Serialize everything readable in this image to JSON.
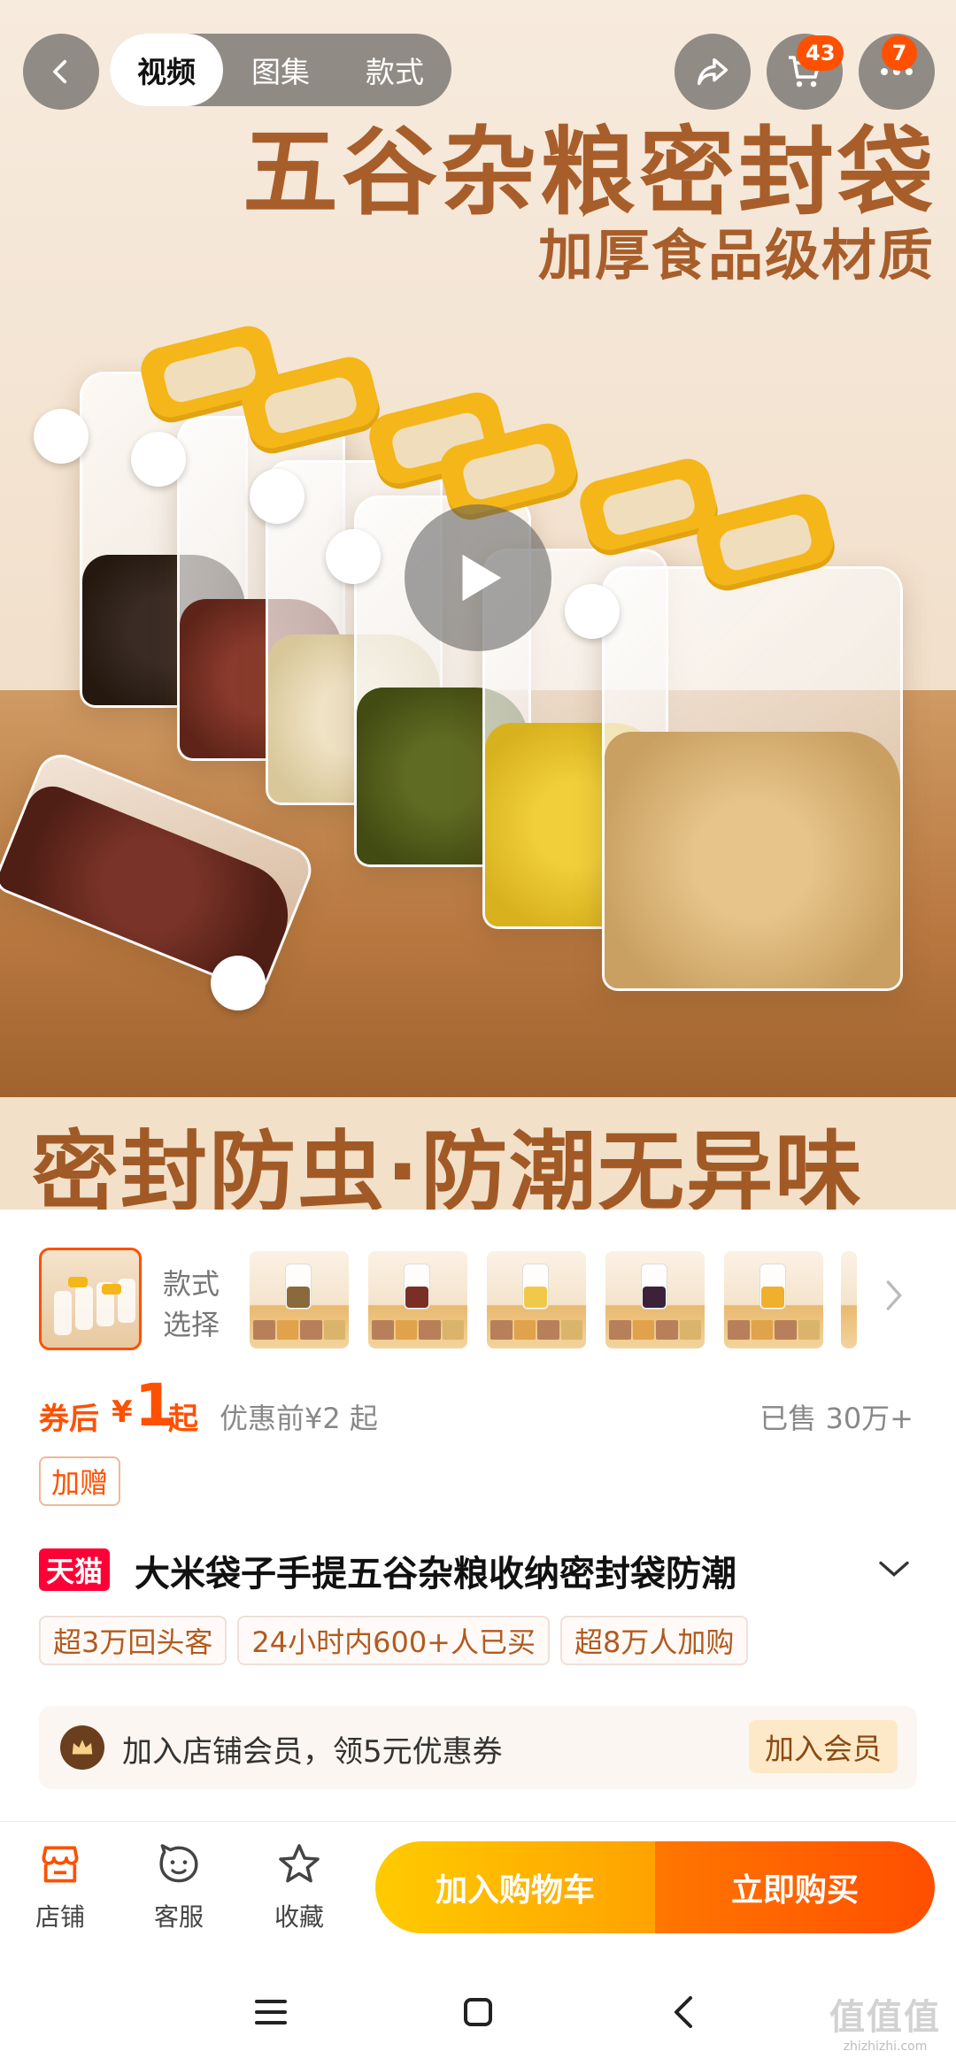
{
  "nav": {
    "media_tabs": [
      "视频",
      "图集",
      "款式"
    ],
    "cart_badge": "43",
    "more_badge": "7"
  },
  "hero": {
    "title": "五谷杂粮密封袋",
    "subtitle": "加厚食品级材质",
    "tagline": "密封防虫·防潮无异味"
  },
  "styles": {
    "label": "款式\n选择"
  },
  "price": {
    "prefix": "券后",
    "currency": "¥",
    "value": "1",
    "suffix": "起",
    "original": "优惠前¥2 起",
    "sold": "已售 30万+"
  },
  "gift_tag": "加赠",
  "product": {
    "platform_badge": "天猫",
    "title": "大米袋子手提五谷杂粮收纳密封袋防潮",
    "tags": [
      "超3万回头客",
      "24小时内600+人已买",
      "超8万人加购"
    ]
  },
  "member": {
    "text": "加入店铺会员，领5元优惠券",
    "button": "加入会员"
  },
  "action_bar": {
    "store": "店铺",
    "service": "客服",
    "favorite": "收藏",
    "add_to_cart": "加入购物车",
    "buy_now": "立即购买"
  },
  "watermark": {
    "logo": "值值值",
    "url": "zhizhizhi.com"
  },
  "colors": {
    "accent": "#ff5000",
    "tmall": "#ff0036",
    "cart_button": "#ffb400",
    "buy_button": "#ff5a00"
  }
}
